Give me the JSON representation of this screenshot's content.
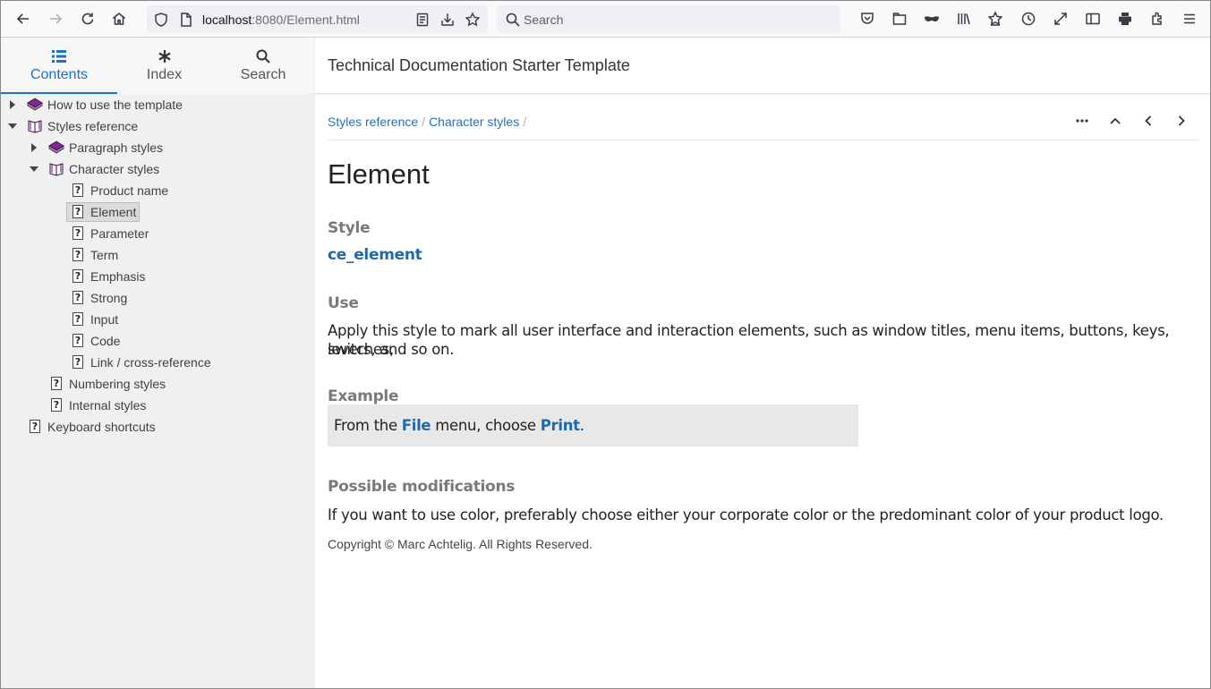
{
  "browser": {
    "url_host": "localhost",
    "url_rest": ":8080/Element.html",
    "search_placeholder": "Search"
  },
  "tabs": [
    {
      "label": "Contents",
      "icon": "list-icon",
      "active": true
    },
    {
      "label": "Index",
      "icon": "asterisk-icon",
      "active": false
    },
    {
      "label": "Search",
      "icon": "search-icon",
      "active": false
    }
  ],
  "tree": [
    {
      "label": "How to use the template"
    },
    {
      "label": "Styles reference"
    },
    {
      "label": "Paragraph styles"
    },
    {
      "label": "Character styles"
    },
    {
      "label": "Product name"
    },
    {
      "label": "Element"
    },
    {
      "label": "Parameter"
    },
    {
      "label": "Term"
    },
    {
      "label": "Emphasis"
    },
    {
      "label": "Strong"
    },
    {
      "label": "Input"
    },
    {
      "label": "Code"
    },
    {
      "label": "Link / cross-reference"
    },
    {
      "label": "Numbering styles"
    },
    {
      "label": "Internal styles"
    },
    {
      "label": "Keyboard shortcuts"
    }
  ],
  "header": {
    "title": "Technical Documentation Starter Template"
  },
  "breadcrumb": {
    "items": [
      "Styles reference",
      "Character styles"
    ],
    "separator": "/"
  },
  "topic": {
    "title": "Element",
    "style_heading": "Style",
    "style_name": "ce_element",
    "use_heading": "Use",
    "use_text_line1": "Apply this style to mark all user interface and interaction elements, such as window titles, menu items, buttons, keys, switches,",
    "use_text_line2": "levers, and so on.",
    "example_heading": "Example",
    "example_prefix": "From the ",
    "example_el1": "File",
    "example_middle": " menu, choose ",
    "example_el2": "Print",
    "example_suffix": ".",
    "mod_heading": "Possible modifications",
    "mod_text": "If you want to use color, preferably choose either your corporate color or the predominant color of your product logo.",
    "copyright": "Copyright © Marc Achtelig. All Rights Reserved."
  },
  "colors": {
    "accent": "#1a73c8",
    "link": "#2a6fb3",
    "ui_element": "#1f6aa6",
    "book_purple": "#6a1f7a"
  }
}
